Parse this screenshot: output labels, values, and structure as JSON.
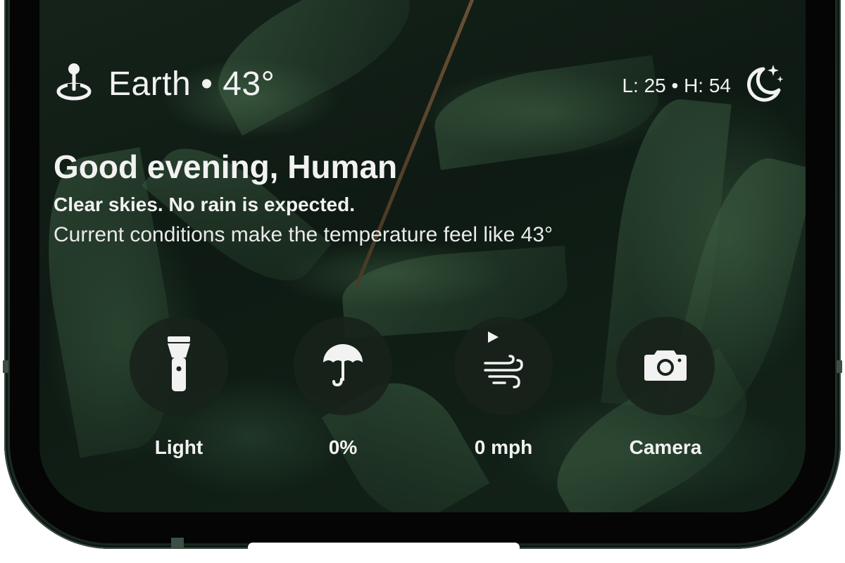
{
  "header": {
    "location": "Earth",
    "separator": "•",
    "temperature": "43°",
    "location_line": "Earth • 43°",
    "hilo": "L: 25 • H: 54",
    "location_icon": "location-pin-icon",
    "weather_icon": "moon-stars-icon"
  },
  "greeting": {
    "title": "Good evening, Human",
    "summary": "Clear skies. No rain is expected.",
    "feels_like": "Current conditions make the temperature feel like 43°"
  },
  "actions": [
    {
      "label": "Light",
      "icon": "flashlight-icon"
    },
    {
      "label": "0%",
      "icon": "umbrella-icon"
    },
    {
      "label": "0 mph",
      "icon": "wind-icon"
    },
    {
      "label": "Camera",
      "icon": "camera-icon"
    }
  ],
  "colors": {
    "text": "#f2f2f2",
    "button_bg": "#18221a",
    "background": "#0e1a13",
    "frame": "#24362c"
  }
}
